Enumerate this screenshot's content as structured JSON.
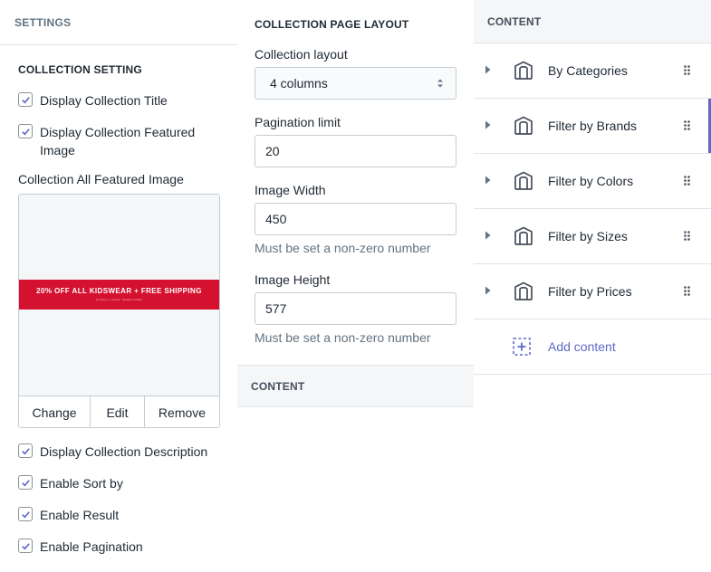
{
  "settings_panel": {
    "header": "SETTINGS",
    "section_title": "COLLECTION SETTING",
    "checkboxes_top": [
      {
        "label": "Display Collection Title",
        "checked": true
      },
      {
        "label": "Display Collection Featured Image",
        "checked": true
      }
    ],
    "featured_image": {
      "label": "Collection All Featured Image",
      "banner_text": "20% OFF ALL KIDSWEAR + FREE SHIPPING",
      "banner_subtext": "in-store + online. details online",
      "banner_color": "#d4122f",
      "buttons": [
        "Change",
        "Edit",
        "Remove"
      ]
    },
    "checkboxes_bottom": [
      {
        "label": "Display Collection Description",
        "checked": true
      },
      {
        "label": "Enable Sort by",
        "checked": true
      },
      {
        "label": "Enable Result",
        "checked": true
      },
      {
        "label": "Enable Pagination",
        "checked": true
      }
    ]
  },
  "layout_panel": {
    "title": "COLLECTION PAGE LAYOUT",
    "collection_layout": {
      "label": "Collection layout",
      "value": "4 columns"
    },
    "pagination_limit": {
      "label": "Pagination limit",
      "value": "20"
    },
    "image_width": {
      "label": "Image Width",
      "value": "450",
      "help": "Must be set a non-zero number"
    },
    "image_height": {
      "label": "Image Height",
      "value": "577",
      "help": "Must be set a non-zero number"
    },
    "content_header": "CONTENT"
  },
  "content_panel": {
    "header": "CONTENT",
    "items": [
      {
        "label": "By Categories",
        "icon": "section-icon"
      },
      {
        "label": "Filter by Brands",
        "icon": "section-icon",
        "active": true
      },
      {
        "label": "Filter by Colors",
        "icon": "section-icon"
      },
      {
        "label": "Filter by Sizes",
        "icon": "section-icon"
      },
      {
        "label": "Filter by Prices",
        "icon": "section-icon"
      }
    ],
    "add_label": "Add content",
    "accent_color": "#5c6ac4"
  }
}
